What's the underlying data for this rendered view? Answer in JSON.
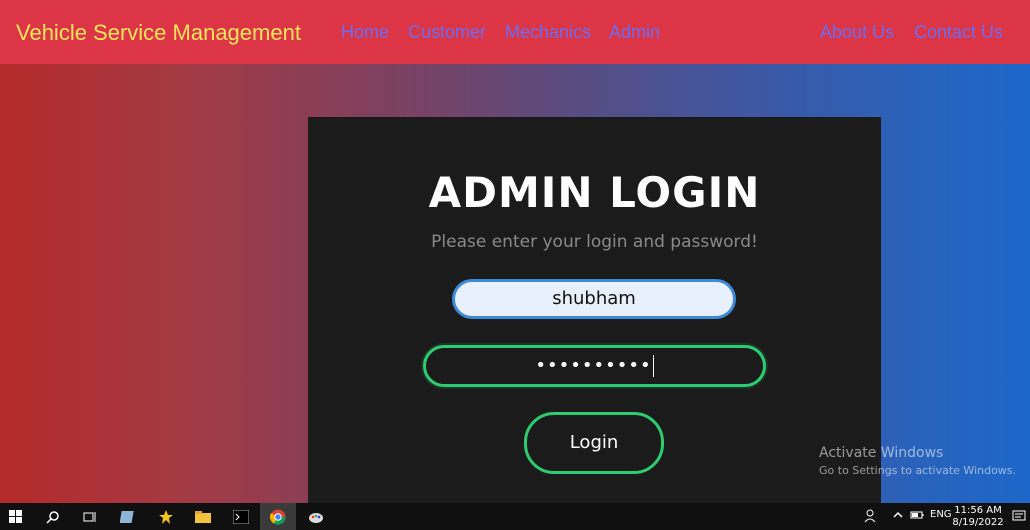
{
  "navbar": {
    "brand": "Vehicle Service Management",
    "links": [
      "Home",
      "Customer",
      "Mechanics",
      "Admin"
    ],
    "right_links": [
      "About Us",
      "Contact Us"
    ]
  },
  "login": {
    "title": "ADMIN LOGIN",
    "subtitle": "Please enter your login and password!",
    "username_value": "shubham",
    "password_value": "••••••••••",
    "button_label": "Login"
  },
  "watermark": {
    "line1": "Activate Windows",
    "line2": "Go to Settings to activate Windows."
  },
  "taskbar": {
    "language": "ENG",
    "time": "11:56 AM",
    "date": "8/19/2022"
  },
  "colors": {
    "navbar": "#dc3545",
    "brand": "#ffe45c",
    "nav_link": "#6f6bf0",
    "card": "#1b1b1b",
    "accent_green": "#2ecc71",
    "input_border": "#3d8ad8"
  }
}
